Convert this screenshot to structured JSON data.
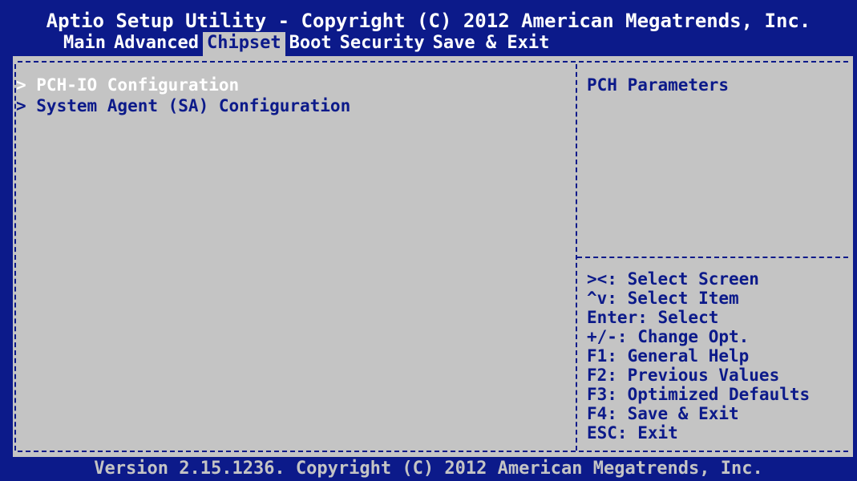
{
  "header": {
    "title": "Aptio Setup Utility - Copyright (C) 2012 American Megatrends, Inc."
  },
  "tabs": [
    {
      "label": "Main"
    },
    {
      "label": "Advanced"
    },
    {
      "label": "Chipset"
    },
    {
      "label": "Boot"
    },
    {
      "label": "Security"
    },
    {
      "label": "Save & Exit"
    }
  ],
  "active_tab": "Chipset",
  "menu": {
    "items": [
      {
        "label": "> PCH-IO Configuration"
      },
      {
        "label": "> System Agent (SA) Configuration"
      }
    ]
  },
  "help": {
    "title": "PCH Parameters"
  },
  "keys": [
    "><: Select Screen",
    "^v: Select Item",
    "Enter: Select",
    "+/-: Change Opt.",
    "F1: General Help",
    "F2: Previous Values",
    "F3: Optimized Defaults",
    "F4: Save & Exit",
    "ESC: Exit"
  ],
  "footer": {
    "text": "Version 2.15.1236. Copyright (C) 2012 American Megatrends, Inc."
  },
  "colors": {
    "background": "#0c1a8a",
    "panel": "#c4c4c4",
    "text_dark": "#0c1a8a",
    "text_light": "#ffffff"
  }
}
